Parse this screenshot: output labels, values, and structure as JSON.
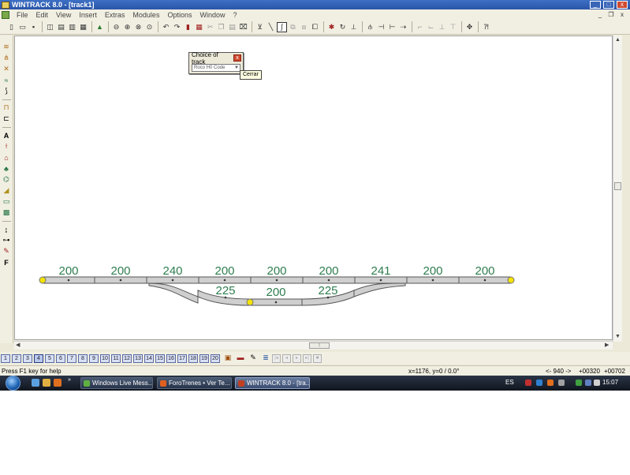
{
  "window": {
    "title": "WINTRACK 8.0 - [track1]",
    "min": "_",
    "max": "□",
    "close": "x"
  },
  "menu": {
    "items": [
      "File",
      "Edit",
      "View",
      "Insert",
      "Extras",
      "Modules",
      "Options",
      "Window",
      "?"
    ],
    "mdi_min": "_",
    "mdi_restore": "❐",
    "mdi_close": "x"
  },
  "dialog": {
    "title": "Choice of track",
    "close": "x",
    "selected": "Roco H0 Code",
    "tooltip": "Cerrar"
  },
  "track": {
    "color": "#2e7d4f",
    "top_labels": [
      "200",
      "200",
      "240",
      "200",
      "200",
      "200",
      "241",
      "200",
      "200"
    ],
    "bottom_labels": [
      "225",
      "200",
      "225"
    ]
  },
  "layers": [
    "1",
    "2",
    "3",
    "4",
    "5",
    "6",
    "7",
    "8",
    "9",
    "10",
    "11",
    "12",
    "13",
    "14",
    "15",
    "16",
    "17",
    "18",
    "19",
    "20"
  ],
  "status": {
    "help": "Press F1 key for help",
    "coords": "x=1176, y=0 / 0.0°",
    "length": "<- 940 ->",
    "pos_a": "+00320",
    "pos_b": "+00702"
  },
  "taskbar": {
    "tasks": [
      "Windows Live Mess...",
      "ForoTrenes • Ver Te...",
      "WINTRACK 8.0 - [tra..."
    ],
    "lang": "ES",
    "time": "15:07"
  }
}
